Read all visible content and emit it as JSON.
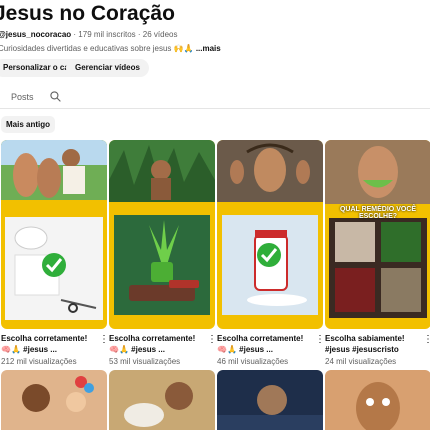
{
  "channel": {
    "name": "Jesus no Coração",
    "handle": "@jesus_nocoracao",
    "subscribers": "179 mil inscritos",
    "videos": "26 vídeos",
    "description": "Curiosidades divertidas e educativas sobre jesus 🙌🙏",
    "more": "...mais"
  },
  "buttons": {
    "customize": "Personalizar o canal",
    "manage": "Gerenciar vídeos"
  },
  "tabs": {
    "posts": "Posts"
  },
  "filter": {
    "label": "Mais antigo"
  },
  "shorts": [
    {
      "title": "Escolha corretamente!",
      "tags": "🧠🙏 #jesus ...",
      "views": "212 mil visualizações"
    },
    {
      "title": "Escolha corretamente!",
      "tags": "🧠🙏 #jesus ...",
      "views": "53 mil visualizações"
    },
    {
      "title": "Escolha corretamente!",
      "tags": "🧠🙏 #jesus ...",
      "views": "46 mil visualizações"
    },
    {
      "title": "Escolha sabiamente!",
      "tags": "#jesus #jesuscristo",
      "views": "24 mil visualizações"
    }
  ],
  "thumb4_caption": "QUAL REMÉDIO VOCÊ ESCOLHE?",
  "colors": {
    "accent_yellow": "#f2c000",
    "check_green": "#2fae3a"
  }
}
